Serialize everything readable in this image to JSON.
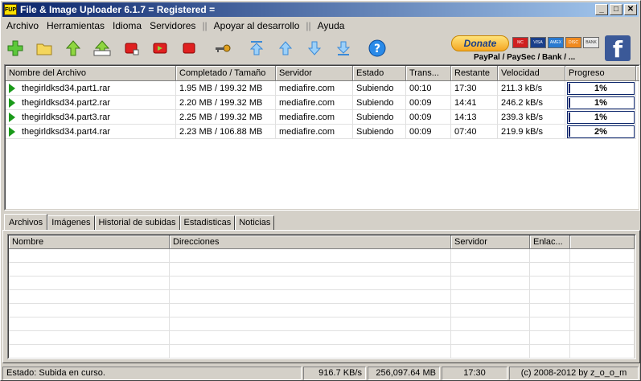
{
  "window": {
    "title": "File & Image Uploader 6.1.7  = Registered =",
    "app_icon_text": "FUP",
    "buttons": {
      "minimize": "_",
      "maximize": "□",
      "close": "✕"
    }
  },
  "menu": {
    "items": [
      "Archivo",
      "Herramientas",
      "Idioma",
      "Servidores"
    ],
    "separator": "||",
    "extra_items": [
      "Apoyar al desarrollo",
      "Ayuda"
    ]
  },
  "toolbar": {
    "icons": [
      "add-file-icon",
      "add-folder-icon",
      "move-up-icon",
      "move-up-all-icon",
      "stop-icon",
      "start-icon",
      "stop-all-icon",
      "key-icon",
      "move-top-icon",
      "move-up-one-icon",
      "move-down-one-icon",
      "move-bottom-icon",
      "help-icon"
    ],
    "donate_label": "Donate",
    "card_labels": [
      "MC",
      "VISA",
      "AMEX",
      "DISC",
      "BANK"
    ],
    "donate_caption": "PayPal / PaySec / Bank / ...",
    "facebook_label": "f"
  },
  "upload_table": {
    "columns": [
      "Nombre del Archivo",
      "Completado / Tamaño",
      "Servidor",
      "Estado",
      "Trans...",
      "Restante",
      "Velocidad",
      "Progreso"
    ],
    "rows": [
      {
        "name": "thegirldksd34.part1.rar",
        "completed": "1.95 MB / 199.32 MB",
        "server": "mediafire.com",
        "status": "Subiendo",
        "trans": "00:10",
        "remaining": "17:30",
        "speed": "211.3 kB/s",
        "progress": "1%",
        "progress_value": 0.01
      },
      {
        "name": "thegirldksd34.part2.rar",
        "completed": "2.20 MB / 199.32 MB",
        "server": "mediafire.com",
        "status": "Subiendo",
        "trans": "00:09",
        "remaining": "14:41",
        "speed": "246.2 kB/s",
        "progress": "1%",
        "progress_value": 0.01
      },
      {
        "name": "thegirldksd34.part3.rar",
        "completed": "2.25 MB / 199.32 MB",
        "server": "mediafire.com",
        "status": "Subiendo",
        "trans": "00:09",
        "remaining": "14:13",
        "speed": "239.3 kB/s",
        "progress": "1%",
        "progress_value": 0.01
      },
      {
        "name": "thegirldksd34.part4.rar",
        "completed": "2.23 MB / 106.88 MB",
        "server": "mediafire.com",
        "status": "Subiendo",
        "trans": "00:09",
        "remaining": "07:40",
        "speed": "219.9 kB/s",
        "progress": "2%",
        "progress_value": 0.02
      }
    ]
  },
  "tabs": [
    "Archivos",
    "Imágenes",
    "Historial de subidas",
    "Estadisticas",
    "Noticias"
  ],
  "active_tab": 0,
  "files_table": {
    "columns": [
      "Nombre",
      "Direcciones",
      "Servidor",
      "Enlac..."
    ]
  },
  "statusbar": {
    "status": "Estado: Subida en curso.",
    "speed": "916.7 KB/s",
    "size": "256,097.64 MB",
    "time": "17:30",
    "copyright": "(c) 2008-2012 by z_o_o_m"
  },
  "colors": {
    "titlebar_start": "#0a246a",
    "titlebar_end": "#a6caf0",
    "progress_fill": "#0a246a",
    "play_icon": "#1a9a1a",
    "facebook": "#3b5998"
  }
}
